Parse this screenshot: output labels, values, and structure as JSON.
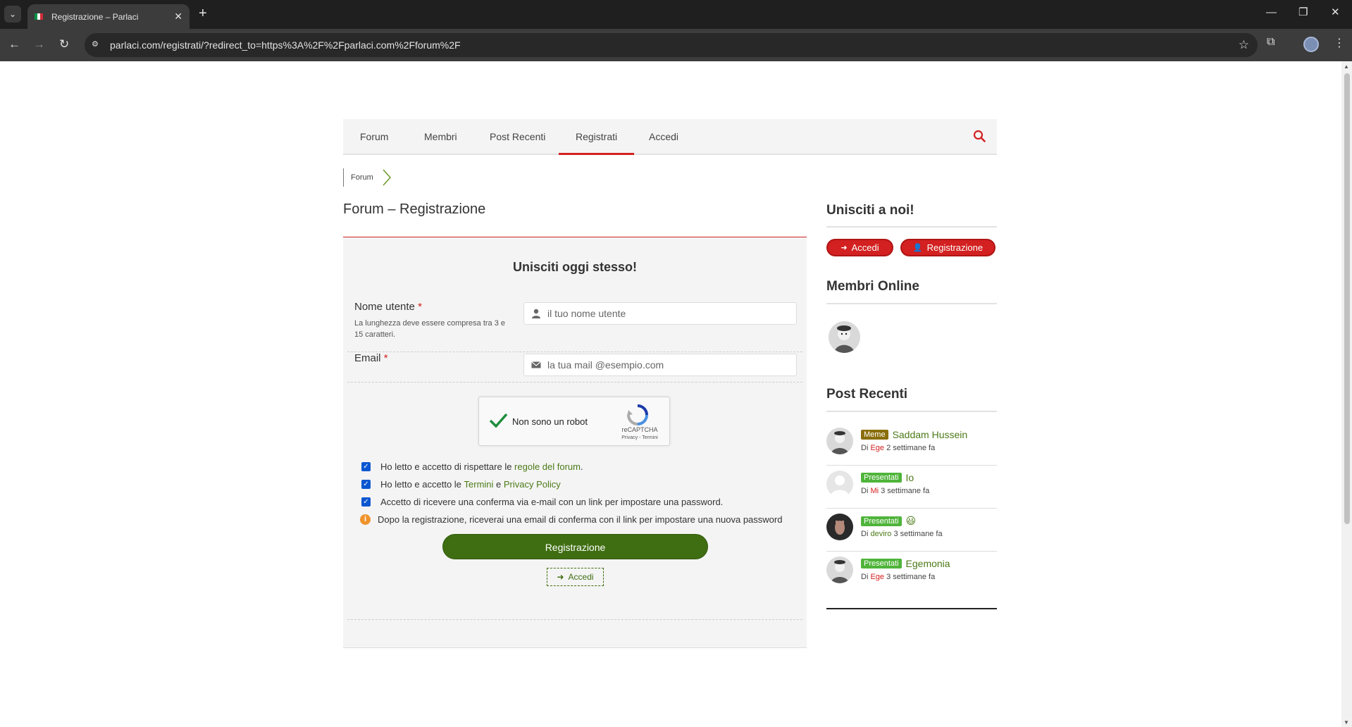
{
  "browser": {
    "tab_title": "Registrazione – Parlaci",
    "url": "parlaci.com/registrati/?redirect_to=https%3A%2F%2Fparlaci.com%2Fforum%2F",
    "icons": [
      "chevron-down-icon",
      "close-icon",
      "plus-icon",
      "back-icon",
      "forward-icon",
      "reload-icon",
      "site-info-icon",
      "star-icon",
      "extensions-icon",
      "profile-icon",
      "more-icon",
      "minimize-icon",
      "restore-icon"
    ]
  },
  "site_nav": {
    "items": [
      "Forum",
      "Membri",
      "Post Recenti",
      "Registrati",
      "Accedi"
    ],
    "active_index": 3
  },
  "breadcrumb": {
    "label": "Forum"
  },
  "page_title": "Forum – Registrazione",
  "form": {
    "heading": "Unisciti oggi stesso!",
    "username_label": "Nome utente",
    "username_desc": "La lunghezza deve essere compresa tra 3 e 15 caratteri.",
    "username_placeholder": "il tuo nome utente",
    "email_label": "Email",
    "email_placeholder": "la tua mail @esempio.com",
    "required_mark": "*",
    "captcha": {
      "label": "Non sono un robot",
      "brand": "reCAPTCHA",
      "links": "Privacy - Termini"
    },
    "check1": {
      "before": "Ho letto e accetto di rispettare le ",
      "link": "regole del forum",
      "after": "."
    },
    "check2": {
      "before": "Ho letto e accetto le ",
      "link1": "Termini",
      "mid": " e ",
      "link2": "Privacy Policy"
    },
    "check3": "Accetto di ricevere una conferma via e-mail con un link per impostare una password.",
    "info": "Dopo la registrazione, riceverai una email di conferma con il link per impostare una nuova password",
    "submit": "Registrazione",
    "login": "Accedi"
  },
  "sidebar": {
    "join_heading": "Unisciti a noi!",
    "login_btn": "Accedi",
    "register_btn": "Registrazione",
    "online_heading": "Membri Online",
    "recent_heading": "Post Recenti",
    "by": "Di",
    "posts": [
      {
        "badge": "Meme",
        "badge_color": "#8a6d0b",
        "title": "Saddam Hussein",
        "author": "Ege",
        "author_color": "red",
        "time": "2 settimane fa"
      },
      {
        "badge": "Presentati",
        "badge_color": "#4fb43a",
        "title": "Io",
        "author": "Mi",
        "author_color": "red",
        "time": "3 settimane fa"
      },
      {
        "badge": "Presentati",
        "badge_color": "#4fb43a",
        "title": "😃",
        "author": "deviro",
        "author_color": "green",
        "time": "3 settimane fa"
      },
      {
        "badge": "Presentati",
        "badge_color": "#4fb43a",
        "title": "Egemonia",
        "author": "Ege",
        "author_color": "red",
        "time": "3 settimane fa"
      }
    ]
  },
  "colors": {
    "accent_red": "#d32020",
    "accent_green": "#3f6e12",
    "link_green": "#4b7a17"
  }
}
